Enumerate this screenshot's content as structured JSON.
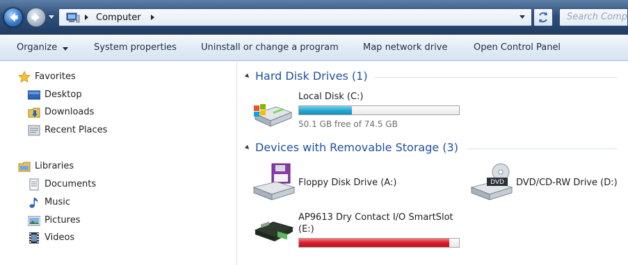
{
  "address_bar": {
    "path_label": "Computer",
    "search_placeholder": "Search Comp"
  },
  "toolbar": {
    "organize": "Organize",
    "system_properties": "System properties",
    "uninstall": "Uninstall or change a program",
    "map_drive": "Map network drive",
    "control_panel": "Open Control Panel"
  },
  "navigation": {
    "favorites": {
      "label": "Favorites",
      "items": [
        {
          "label": "Desktop",
          "icon": "desktop-icon"
        },
        {
          "label": "Downloads",
          "icon": "downloads-icon"
        },
        {
          "label": "Recent Places",
          "icon": "recent-places-icon"
        }
      ]
    },
    "libraries": {
      "label": "Libraries",
      "items": [
        {
          "label": "Documents",
          "icon": "documents-icon"
        },
        {
          "label": "Music",
          "icon": "music-icon"
        },
        {
          "label": "Pictures",
          "icon": "pictures-icon"
        },
        {
          "label": "Videos",
          "icon": "videos-icon"
        }
      ]
    }
  },
  "content": {
    "hard_disk_group": {
      "label": "Hard Disk Drives (1)",
      "drives": [
        {
          "name": "Local Disk (C:)",
          "free_text": "50.1 GB free of 74.5 GB",
          "used_fraction": 0.33,
          "bar_color": "#26a8d4"
        }
      ]
    },
    "removable_group": {
      "label": "Devices with Removable Storage (3)",
      "drives": [
        {
          "name": "Floppy Disk Drive (A:)",
          "icon": "floppy-drive-icon"
        },
        {
          "name": "DVD/CD-RW Drive (D:)",
          "icon": "dvd-drive-icon"
        },
        {
          "name": "AP9613 Dry Contact I/O SmartSlot",
          "name_line2": "(E:)",
          "icon": "smartslot-card-icon",
          "used_fraction": 0.94,
          "bar_color": "#d91f2b"
        }
      ]
    }
  },
  "colors": {
    "group_heading": "#1e4fa0",
    "address_bar": "#2f4f7a",
    "toolbar": "#e3ecf6"
  }
}
